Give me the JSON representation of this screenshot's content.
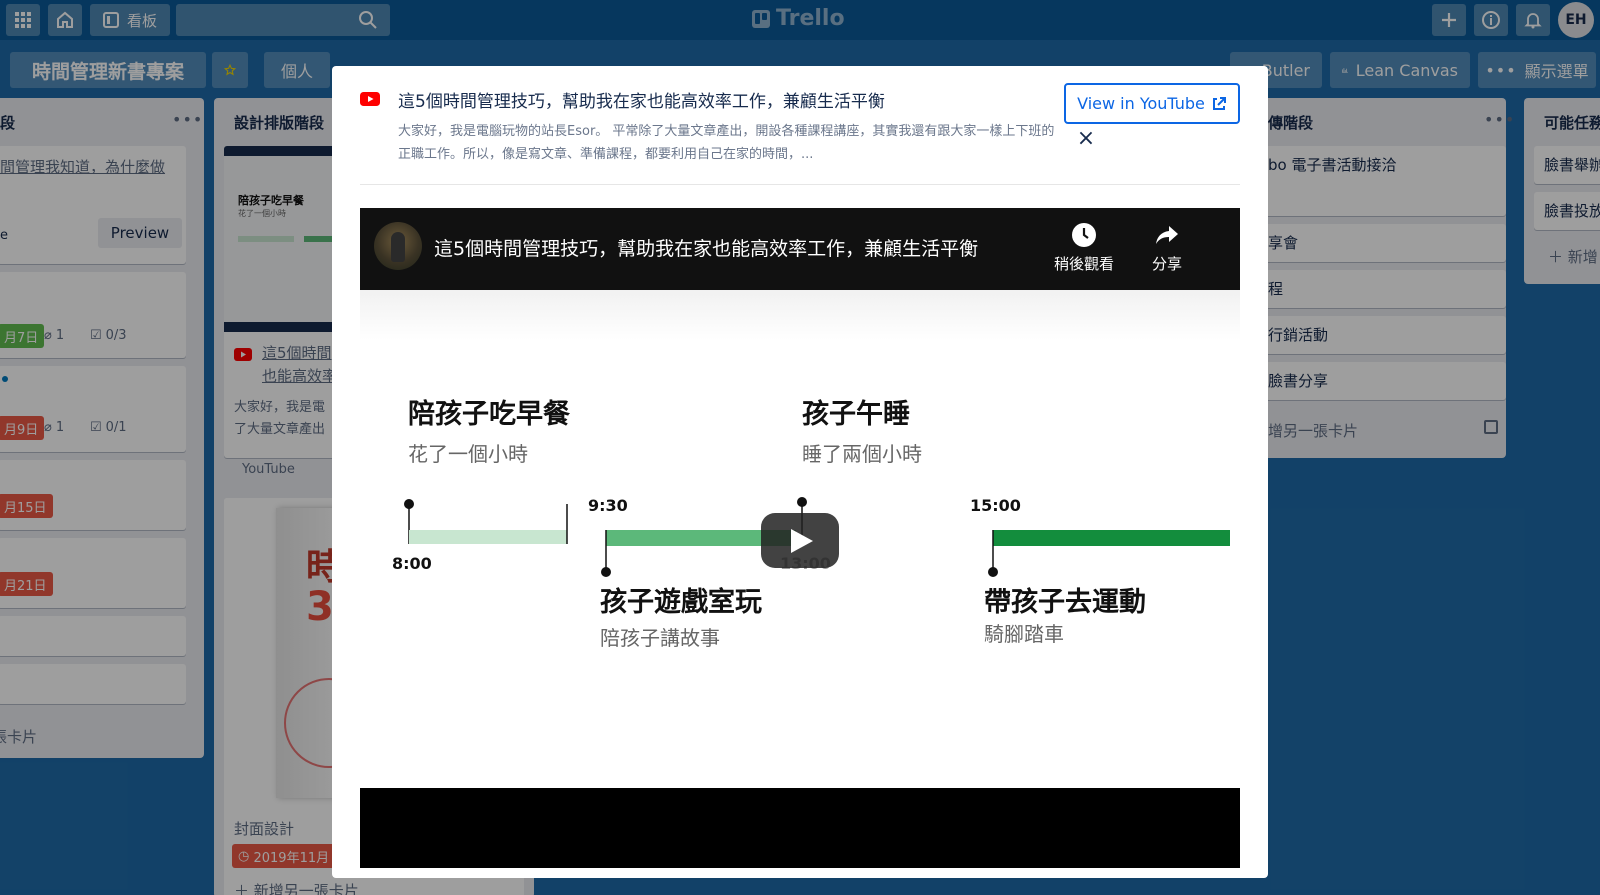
{
  "header": {
    "boards_label": "看板",
    "logo_text": "Trello",
    "avatar_initials": "EH"
  },
  "board": {
    "title": "時間管理新書專案",
    "visibility": "個人",
    "butler": "Butler",
    "lean_canvas": "Lean Canvas",
    "show_menu": "顯示選單"
  },
  "lists": {
    "left": {
      "title_fragment": "段",
      "card1_text": "間管理我知道，為什麼做",
      "preview_label": "Preview",
      "card1_fragment": "e",
      "date1": "月7日",
      "attach1": "1",
      "check1": "0/3",
      "date2": "月9日",
      "attach2": "1",
      "check2": "0/1",
      "date3": "月15日",
      "date4": "月21日",
      "add_card": "張卡片"
    },
    "design": {
      "title": "設計排版階段",
      "thumb_title": "陪孩子吃早餐",
      "thumb_sub": "花了一個小時",
      "link_line1": "這5個時間",
      "link_line2": "也能高效率",
      "desc_line1": "大家好，我是電",
      "desc_line2": "了大量文章產出",
      "source": "YouTube",
      "book_char1": "時",
      "book_char2": "30",
      "cover_label": "封面設計",
      "cover_date": "2019年11月",
      "add_card": "新增另一張卡片"
    },
    "promo": {
      "title": "傳階段",
      "card1": "bo 電子書活動接洽",
      "card2": "享會",
      "card3": "程",
      "card4": "行銷活動",
      "card5": "臉書分享",
      "add_card": "增另一張卡片"
    },
    "possible": {
      "title": "可能任務",
      "card1": "臉書舉辦",
      "card2": "臉書投放",
      "add_card": "新增"
    }
  },
  "modal": {
    "title": "這5個時間管理技巧，幫助我在家也能高效率工作，兼顧生活平衡",
    "description": "大家好，我是電腦玩物的站長Esor。 平常除了大量文章產出，開設各種課程講座，其實我還有跟大家一樣上下班的正職工作。所以，像是寫文章、準備課程，都要利用自己在家的時間，...",
    "view_button": "View in YouTube",
    "close": "×"
  },
  "video": {
    "title": "這5個時間管理技巧，幫助我在家也能高效率工作，兼顧生活平衡",
    "watch_later": "稍後觀看",
    "share": "分享",
    "timeline": {
      "e1_title": "陪孩子吃早餐",
      "e1_sub": "花了一個小時",
      "e2_title": "孩子午睡",
      "e2_sub": "睡了兩個小時",
      "e3_title": "孩子遊戲室玩",
      "e3_sub": "陪孩子講故事",
      "e4_title": "帶孩子去運動",
      "e4_sub": "騎腳踏車",
      "t1": "8:00",
      "t2": "9:30",
      "t3": "13:00",
      "t4": "15:00"
    }
  },
  "colors": {
    "board_bg": "#1e6aa8",
    "youtube_red": "#ff0000",
    "link_blue": "#0c66e4",
    "date_green": "#61bd4f",
    "date_red": "#eb5a46",
    "bar_light": "#c8e6d0",
    "bar_mid": "#5cb87a",
    "bar_dark": "#138d3d"
  },
  "icons": [
    "apps-grid-icon",
    "home-icon",
    "board-icon",
    "search-icon",
    "star-icon",
    "plus-icon",
    "info-icon",
    "bell-icon",
    "youtube-icon",
    "external-link-icon",
    "close-icon",
    "clock-icon",
    "share-icon",
    "play-icon",
    "paperclip-icon",
    "checklist-icon",
    "menu-dots-icon"
  ]
}
